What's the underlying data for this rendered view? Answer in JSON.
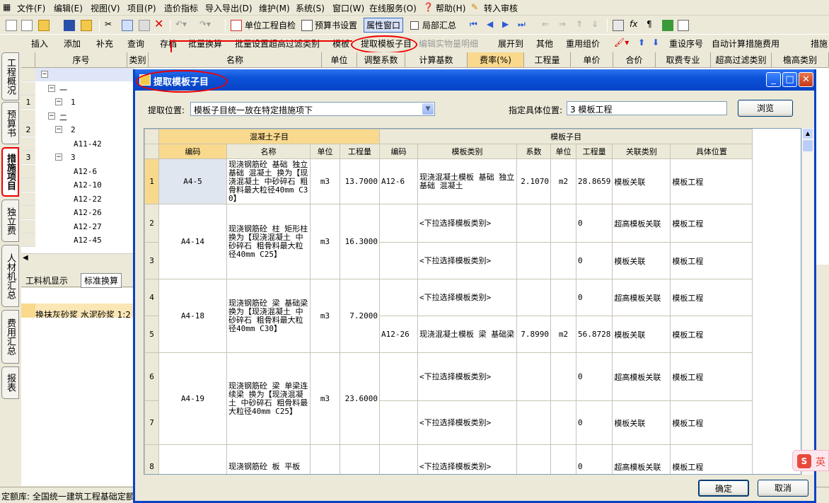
{
  "menu": [
    "文件(F)",
    "编辑(E)",
    "视图(V)",
    "项目(P)",
    "造价指标",
    "导入导出(D)",
    "维护(M)",
    "系统(S)",
    "窗口(W)",
    "在线服务(O)",
    "帮助(H)",
    "转入审核"
  ],
  "toolbar1": {
    "unit_check": "单位工程自检",
    "budget_settings": "预算书设置",
    "property_window": "属性窗口",
    "partial_summary": "局部汇总"
  },
  "toolbar2": [
    "插入",
    "添加",
    "补充",
    "查询",
    "存档",
    "批量换算",
    "批量设置超高过滤类别",
    "模板",
    "提取模板子目",
    "编辑实物量明细",
    "展开到",
    "其他",
    "重用组价",
    "重设序号",
    "自动计算措施费用",
    "措施"
  ],
  "left_tabs": [
    "工程概况",
    "预算书",
    "措施项目",
    "独立费",
    "人材机汇总",
    "费用汇总",
    "报表"
  ],
  "bg_headers": [
    "序号",
    "类别",
    "名称",
    "单位",
    "调整系数",
    "计算基数",
    "费率(%)",
    "工程量",
    "单价",
    "合价",
    "取费专业",
    "超高过滤类别",
    "檐高类别"
  ],
  "bg_rows": [
    {
      "no": "",
      "code": "",
      "level": 0
    },
    {
      "no": "",
      "code": "一",
      "level": 1
    },
    {
      "no": "1",
      "code": "1",
      "level": 2
    },
    {
      "no": "",
      "code": "二",
      "level": 1
    },
    {
      "no": "2",
      "code": "2",
      "level": 2
    },
    {
      "no": "",
      "code": "A11-42",
      "level": 3
    },
    {
      "no": "3",
      "code": "3",
      "level": 2
    },
    {
      "no": "",
      "code": "A12-6",
      "level": 3
    },
    {
      "no": "",
      "code": "A12-10",
      "level": 3
    },
    {
      "no": "",
      "code": "A12-22",
      "level": 3
    },
    {
      "no": "",
      "code": "A12-26",
      "level": 3
    },
    {
      "no": "",
      "code": "A12-27",
      "level": 3
    },
    {
      "no": "",
      "code": "A12-45",
      "level": 3
    }
  ],
  "bottom_tabs": [
    "工料机显示",
    "标准换算"
  ],
  "bottom_row": "换抹灰砂浆 水泥砂浆 1:2",
  "status_text": "定额库: 全国统一建筑工程基础定额",
  "dialog": {
    "title": "提取模板子目",
    "fetch_position_label": "提取位置:",
    "fetch_position_value": "模板子目统一放在特定措施项下",
    "specific_position_label": "指定具体位置:",
    "specific_position_value": "3 模板工程",
    "browse": "浏览",
    "ok": "确定",
    "cancel": "取消",
    "group_concrete": "混凝土子目",
    "group_formwork": "模板子目",
    "columns": [
      "编码",
      "名称",
      "单位",
      "工程量",
      "编码",
      "模板类别",
      "系数",
      "单位",
      "工程量",
      "关联类别",
      "具体位置"
    ],
    "groups": [
      {
        "code": "A4-5",
        "name": "现浇钢筋砼 基础 独立基础 混凝土 换为【现浇混凝土 中砂碎石 粗骨料最大粒径40mm C30】",
        "unit": "m3",
        "qty": "13.7000",
        "rows": [
          {
            "no": "1",
            "fcode": "A12-6",
            "ftype": "现浇混凝土模板 基础 独立基础 混凝土",
            "coef": "2.1070",
            "funit": "m2",
            "fqty": "28.8659",
            "rel": "模板关联",
            "pos": "模板工程"
          }
        ]
      },
      {
        "code": "A4-14",
        "name": "现浇钢筋砼 柱 矩形柱 换为【现浇混凝土 中砂碎石 粗骨料最大粒径40mm C25】",
        "unit": "m3",
        "qty": "16.3000",
        "rows": [
          {
            "no": "2",
            "fcode": "",
            "ftype": "<下拉选择模板类别>",
            "coef": "",
            "funit": "",
            "fqty": "0",
            "rel": "超高模板关联",
            "pos": "模板工程"
          },
          {
            "no": "3",
            "fcode": "",
            "ftype": "<下拉选择模板类别>",
            "coef": "",
            "funit": "",
            "fqty": "0",
            "rel": "模板关联",
            "pos": "模板工程"
          }
        ]
      },
      {
        "code": "A4-18",
        "name": "现浇钢筋砼 梁 基础梁 换为【现浇混凝土 中砂碎石 粗骨料最大粒径40mm C30】",
        "unit": "m3",
        "qty": "7.2000",
        "rows": [
          {
            "no": "4",
            "fcode": "",
            "ftype": "<下拉选择模板类别>",
            "coef": "",
            "funit": "",
            "fqty": "0",
            "rel": "超高模板关联",
            "pos": "模板工程"
          },
          {
            "no": "5",
            "fcode": "A12-26",
            "ftype": "现浇混凝土模板 梁 基础梁",
            "coef": "7.8990",
            "funit": "m2",
            "fqty": "56.8728",
            "rel": "模板关联",
            "pos": "模板工程"
          }
        ]
      },
      {
        "code": "A4-19",
        "name": "现浇钢筋砼 梁 单梁连续梁 换为【现浇混凝土 中砂碎石 粗骨料最大粒径40mm C25】",
        "unit": "m3",
        "qty": "23.6000",
        "rows": [
          {
            "no": "6",
            "fcode": "",
            "ftype": "<下拉选择模板类别>",
            "coef": "",
            "funit": "",
            "fqty": "0",
            "rel": "超高模板关联",
            "pos": "模板工程"
          },
          {
            "no": "7",
            "fcode": "",
            "ftype": "<下拉选择模板类别>",
            "coef": "",
            "funit": "",
            "fqty": "0",
            "rel": "模板关联",
            "pos": "模板工程"
          }
        ]
      },
      {
        "code": "",
        "name": "现浇钢筋砼 板 平板",
        "unit": "",
        "qty": "",
        "rows": [
          {
            "no": "8",
            "fcode": "",
            "ftype": "<下拉选择模板类别>",
            "coef": "",
            "funit": "",
            "fqty": "0",
            "rel": "超高模板关联",
            "pos": "模板工程"
          }
        ]
      }
    ]
  },
  "ime_label": "英"
}
